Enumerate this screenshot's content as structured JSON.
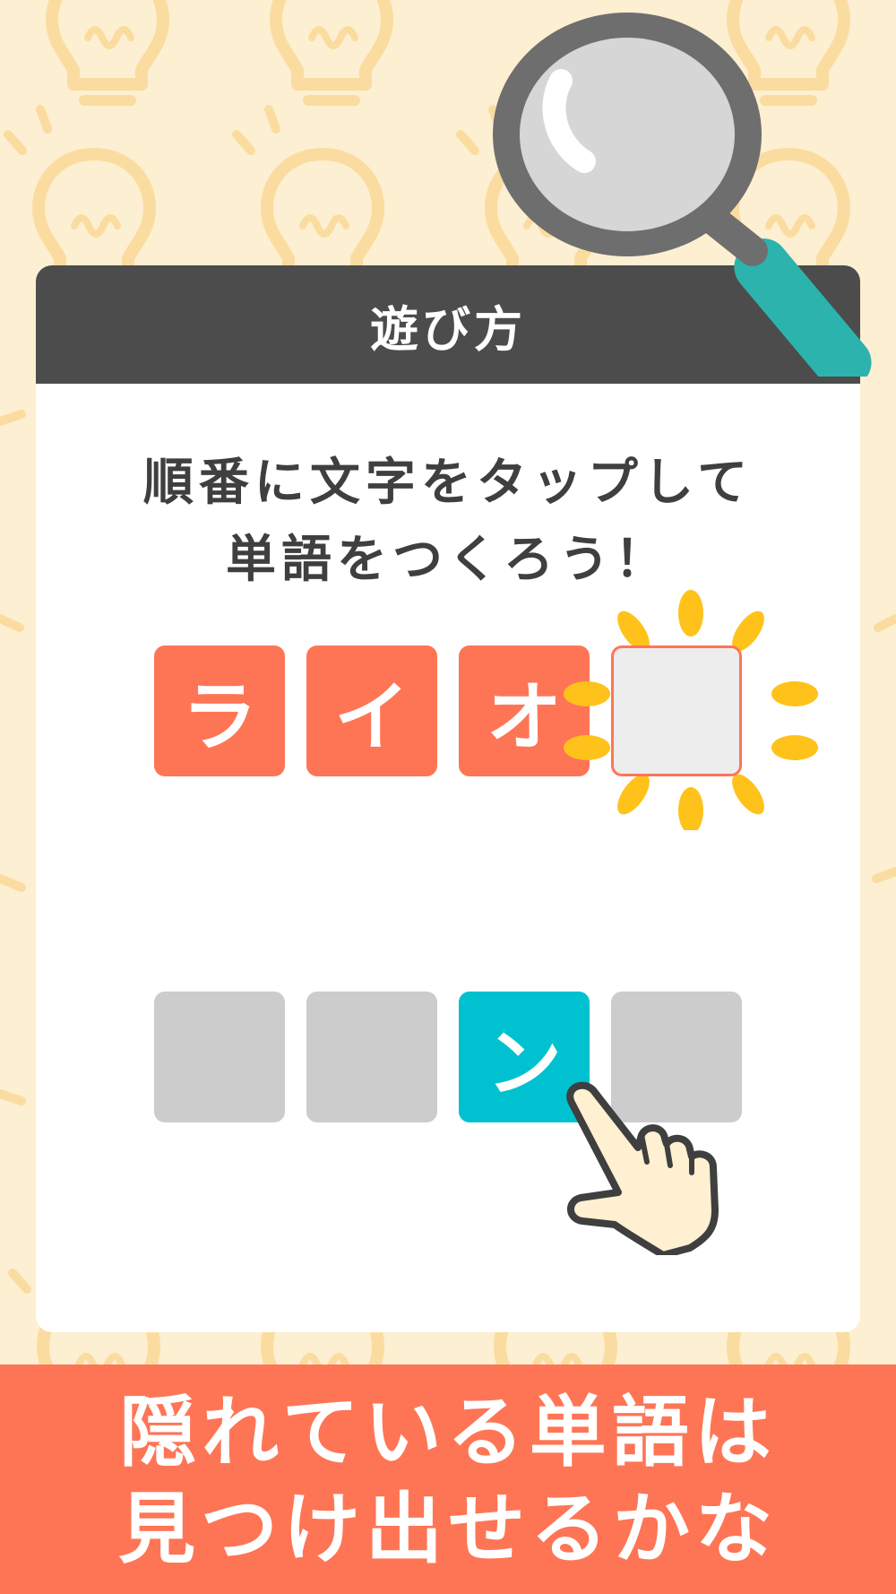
{
  "header": {
    "title": "遊び方"
  },
  "instruction": {
    "line1": "順番に文字をタップして",
    "line2": "単語をつくろう！"
  },
  "word_row": {
    "tiles": [
      "ラ",
      "イ",
      "オ",
      ""
    ]
  },
  "choice_row": {
    "tiles": [
      "",
      "",
      "ン",
      ""
    ]
  },
  "footer": {
    "line1": "隠れている単語は",
    "line2": "見つけ出せるかな"
  },
  "colors": {
    "background": "#fdefd2",
    "header": "#4c4c4c",
    "accent_orange": "#fe7556",
    "accent_teal": "#00c1cf",
    "burst_yellow": "#ffc21a",
    "tile_gray": "#cccccc"
  },
  "icons": {
    "magnifier": "magnifying-glass-icon",
    "hand": "pointing-hand-icon",
    "burst": "sparkle-burst-icon",
    "background": "lightbulb-icon"
  }
}
